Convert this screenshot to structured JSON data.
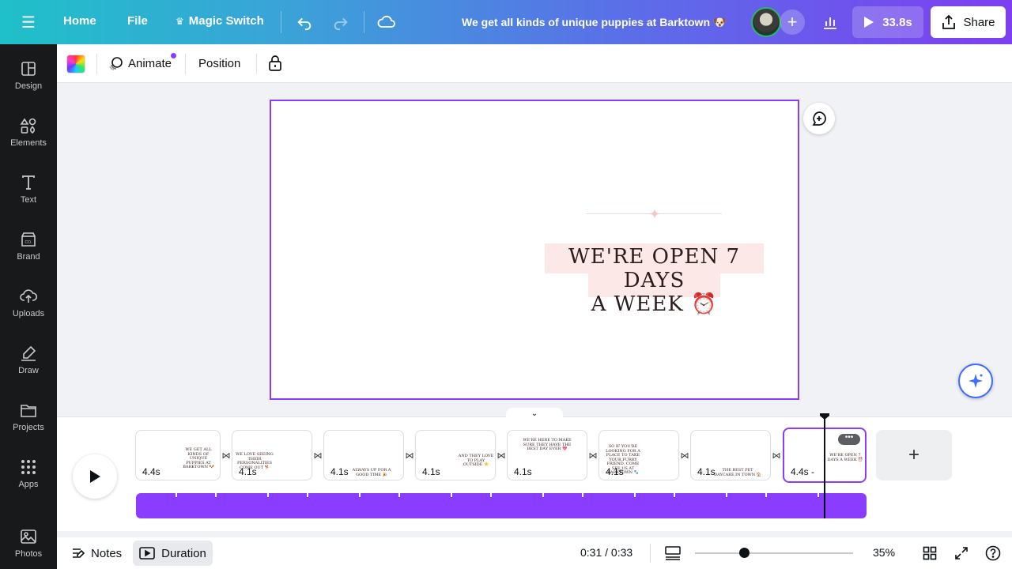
{
  "topbar": {
    "home": "Home",
    "file": "File",
    "magic_switch": "Magic Switch",
    "title": "We get all kinds of unique puppies at Barktown 🐶",
    "play_duration": "33.8s",
    "share": "Share"
  },
  "sidebar": {
    "items": [
      {
        "label": "Design",
        "icon": "design-icon"
      },
      {
        "label": "Elements",
        "icon": "elements-icon"
      },
      {
        "label": "Text",
        "icon": "text-icon"
      },
      {
        "label": "Brand",
        "icon": "brand-icon"
      },
      {
        "label": "Uploads",
        "icon": "uploads-icon"
      },
      {
        "label": "Draw",
        "icon": "draw-icon"
      },
      {
        "label": "Projects",
        "icon": "projects-icon"
      },
      {
        "label": "Apps",
        "icon": "apps-icon"
      },
      {
        "label": "Photos",
        "icon": "photos-icon"
      }
    ]
  },
  "context_toolbar": {
    "animate": "Animate",
    "position": "Position"
  },
  "canvas": {
    "headline_line1": "WE'RE OPEN 7 DAYS",
    "headline_line2": "A WEEK ⏰"
  },
  "timeline": {
    "clips": [
      {
        "duration": "4.4s",
        "text": "WE GET ALL KINDS OF UNIQUE PUPPIES AT BARKTOWN 🐶"
      },
      {
        "duration": "4.1s",
        "text": "WE LOVE SEEING THEIR PERSONALITIES COME OUT 🐕"
      },
      {
        "duration": "4.1s",
        "text": "ALWAYS UP FOR A GOOD TIME 🎉"
      },
      {
        "duration": "4.1s",
        "text": "AND THEY LOVE TO PLAY OUTSIDE ☀️"
      },
      {
        "duration": "4.1s",
        "text": "WE'RE HERE TO MAKE SURE THEY HAVE THE BEST DAY EVER 💖"
      },
      {
        "duration": "4.1s",
        "text": "SO IF YOU'RE LOOKING FOR A PLACE TO TAKE YOUR FURRY FRIEND, COME SEE US AT BARKTOWN 🐾"
      },
      {
        "duration": "4.1s",
        "text": "THE BEST PET DAYCARE IN TOWN 🏠"
      },
      {
        "duration": "4.4s -",
        "text": "WE'RE OPEN 7 DAYS A WEEK ⏰"
      }
    ],
    "more_label": "•••"
  },
  "footer": {
    "notes": "Notes",
    "duration": "Duration",
    "time": "0:31 / 0:33",
    "zoom": "35%",
    "zoom_level": 35
  },
  "colors": {
    "accent": "#8b3dff",
    "headline_bg": "#fde8e8",
    "sidebar_bg": "#18191b"
  }
}
